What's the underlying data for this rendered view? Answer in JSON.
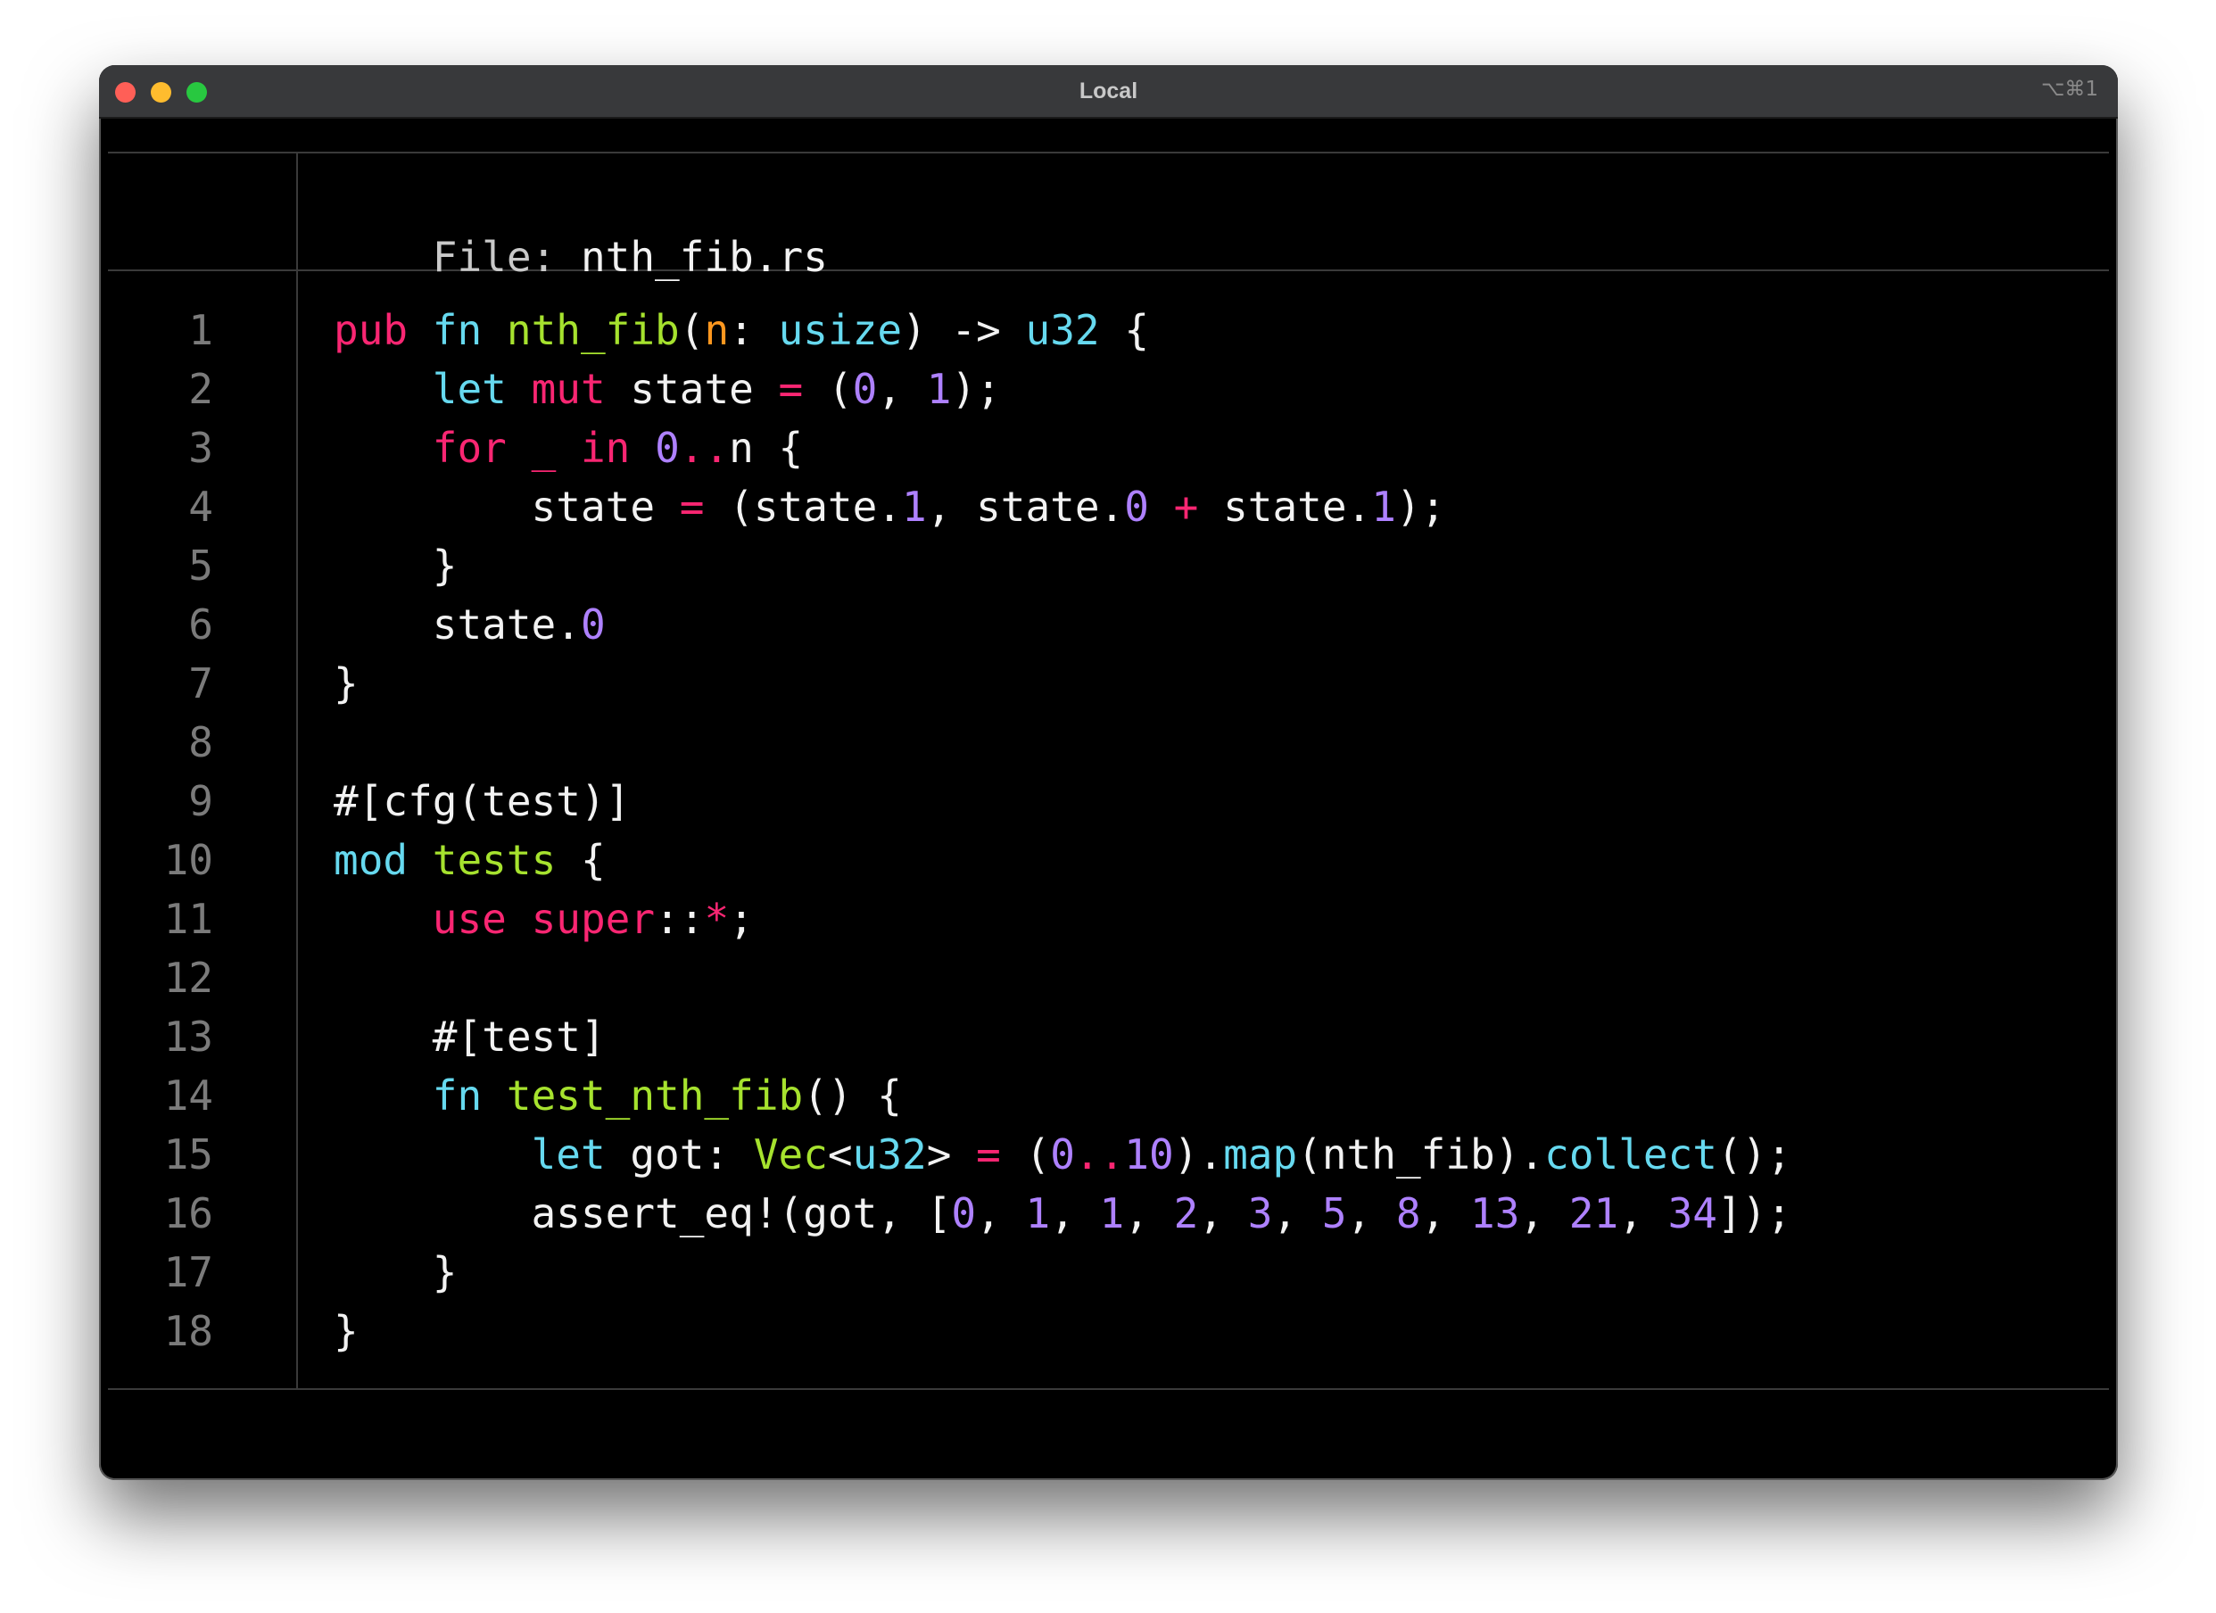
{
  "window": {
    "title": "Local",
    "shortcut": "⌥⌘1",
    "colors": {
      "close": "#ff5f57",
      "minimize": "#febc2e",
      "zoom": "#28c840",
      "background": "#000000",
      "titlebar": "#38393b"
    }
  },
  "file_header": {
    "label": "File:",
    "name": "nth_fib.rs"
  },
  "editor": {
    "language": "rust",
    "lines": [
      {
        "number": "1",
        "tokens": [
          {
            "t": "pub",
            "c": "kw"
          },
          {
            "t": " ",
            "c": "plain"
          },
          {
            "t": "fn",
            "c": "kw2"
          },
          {
            "t": " ",
            "c": "plain"
          },
          {
            "t": "nth_fib",
            "c": "fn"
          },
          {
            "t": "(",
            "c": "plain"
          },
          {
            "t": "n",
            "c": "param"
          },
          {
            "t": ": ",
            "c": "plain"
          },
          {
            "t": "usize",
            "c": "kw2"
          },
          {
            "t": ") -> ",
            "c": "plain"
          },
          {
            "t": "u32",
            "c": "kw2"
          },
          {
            "t": " {",
            "c": "plain"
          }
        ]
      },
      {
        "number": "2",
        "tokens": [
          {
            "t": "    ",
            "c": "plain"
          },
          {
            "t": "let",
            "c": "kw2"
          },
          {
            "t": " ",
            "c": "plain"
          },
          {
            "t": "mut",
            "c": "kw"
          },
          {
            "t": " state ",
            "c": "plain"
          },
          {
            "t": "=",
            "c": "kw"
          },
          {
            "t": " (",
            "c": "plain"
          },
          {
            "t": "0",
            "c": "num"
          },
          {
            "t": ", ",
            "c": "plain"
          },
          {
            "t": "1",
            "c": "num"
          },
          {
            "t": ");",
            "c": "plain"
          }
        ]
      },
      {
        "number": "3",
        "tokens": [
          {
            "t": "    ",
            "c": "plain"
          },
          {
            "t": "for",
            "c": "kw"
          },
          {
            "t": " ",
            "c": "plain"
          },
          {
            "t": "_",
            "c": "kw"
          },
          {
            "t": " ",
            "c": "plain"
          },
          {
            "t": "in",
            "c": "kw"
          },
          {
            "t": " ",
            "c": "plain"
          },
          {
            "t": "0",
            "c": "num"
          },
          {
            "t": "..",
            "c": "kw"
          },
          {
            "t": "n {",
            "c": "plain"
          }
        ]
      },
      {
        "number": "4",
        "tokens": [
          {
            "t": "        state ",
            "c": "plain"
          },
          {
            "t": "=",
            "c": "kw"
          },
          {
            "t": " (state.",
            "c": "plain"
          },
          {
            "t": "1",
            "c": "num"
          },
          {
            "t": ", state.",
            "c": "plain"
          },
          {
            "t": "0",
            "c": "num"
          },
          {
            "t": " ",
            "c": "plain"
          },
          {
            "t": "+",
            "c": "kw"
          },
          {
            "t": " state.",
            "c": "plain"
          },
          {
            "t": "1",
            "c": "num"
          },
          {
            "t": ");",
            "c": "plain"
          }
        ]
      },
      {
        "number": "5",
        "tokens": [
          {
            "t": "    }",
            "c": "plain"
          }
        ]
      },
      {
        "number": "6",
        "tokens": [
          {
            "t": "    state.",
            "c": "plain"
          },
          {
            "t": "0",
            "c": "num"
          }
        ]
      },
      {
        "number": "7",
        "tokens": [
          {
            "t": "}",
            "c": "plain"
          }
        ]
      },
      {
        "number": "8",
        "tokens": []
      },
      {
        "number": "9",
        "tokens": [
          {
            "t": "#[cfg(test)]",
            "c": "plain"
          }
        ]
      },
      {
        "number": "10",
        "tokens": [
          {
            "t": "mod",
            "c": "kw2"
          },
          {
            "t": " ",
            "c": "plain"
          },
          {
            "t": "tests",
            "c": "fn"
          },
          {
            "t": " {",
            "c": "plain"
          }
        ]
      },
      {
        "number": "11",
        "tokens": [
          {
            "t": "    ",
            "c": "plain"
          },
          {
            "t": "use",
            "c": "kw"
          },
          {
            "t": " ",
            "c": "plain"
          },
          {
            "t": "super",
            "c": "kw"
          },
          {
            "t": "::",
            "c": "plain"
          },
          {
            "t": "*",
            "c": "kw"
          },
          {
            "t": ";",
            "c": "plain"
          }
        ]
      },
      {
        "number": "12",
        "tokens": []
      },
      {
        "number": "13",
        "tokens": [
          {
            "t": "    #[test]",
            "c": "plain"
          }
        ]
      },
      {
        "number": "14",
        "tokens": [
          {
            "t": "    ",
            "c": "plain"
          },
          {
            "t": "fn",
            "c": "kw2"
          },
          {
            "t": " ",
            "c": "plain"
          },
          {
            "t": "test_nth_fib",
            "c": "fn"
          },
          {
            "t": "() {",
            "c": "plain"
          }
        ]
      },
      {
        "number": "15",
        "tokens": [
          {
            "t": "        ",
            "c": "plain"
          },
          {
            "t": "let",
            "c": "kw2"
          },
          {
            "t": " got: ",
            "c": "plain"
          },
          {
            "t": "Vec",
            "c": "fn"
          },
          {
            "t": "<",
            "c": "plain"
          },
          {
            "t": "u32",
            "c": "kw2"
          },
          {
            "t": "> ",
            "c": "plain"
          },
          {
            "t": "=",
            "c": "kw"
          },
          {
            "t": " (",
            "c": "plain"
          },
          {
            "t": "0",
            "c": "num"
          },
          {
            "t": "..",
            "c": "kw"
          },
          {
            "t": "10",
            "c": "num"
          },
          {
            "t": ").",
            "c": "plain"
          },
          {
            "t": "map",
            "c": "kw2"
          },
          {
            "t": "(nth_fib).",
            "c": "plain"
          },
          {
            "t": "collect",
            "c": "kw2"
          },
          {
            "t": "();",
            "c": "plain"
          }
        ]
      },
      {
        "number": "16",
        "tokens": [
          {
            "t": "        assert_eq!(got, [",
            "c": "plain"
          },
          {
            "t": "0",
            "c": "num"
          },
          {
            "t": ", ",
            "c": "plain"
          },
          {
            "t": "1",
            "c": "num"
          },
          {
            "t": ", ",
            "c": "plain"
          },
          {
            "t": "1",
            "c": "num"
          },
          {
            "t": ", ",
            "c": "plain"
          },
          {
            "t": "2",
            "c": "num"
          },
          {
            "t": ", ",
            "c": "plain"
          },
          {
            "t": "3",
            "c": "num"
          },
          {
            "t": ", ",
            "c": "plain"
          },
          {
            "t": "5",
            "c": "num"
          },
          {
            "t": ", ",
            "c": "plain"
          },
          {
            "t": "8",
            "c": "num"
          },
          {
            "t": ", ",
            "c": "plain"
          },
          {
            "t": "13",
            "c": "num"
          },
          {
            "t": ", ",
            "c": "plain"
          },
          {
            "t": "21",
            "c": "num"
          },
          {
            "t": ", ",
            "c": "plain"
          },
          {
            "t": "34",
            "c": "num"
          },
          {
            "t": "]);",
            "c": "plain"
          }
        ]
      },
      {
        "number": "17",
        "tokens": [
          {
            "t": "    }",
            "c": "plain"
          }
        ]
      },
      {
        "number": "18",
        "tokens": [
          {
            "t": "}",
            "c": "plain"
          }
        ]
      }
    ]
  }
}
